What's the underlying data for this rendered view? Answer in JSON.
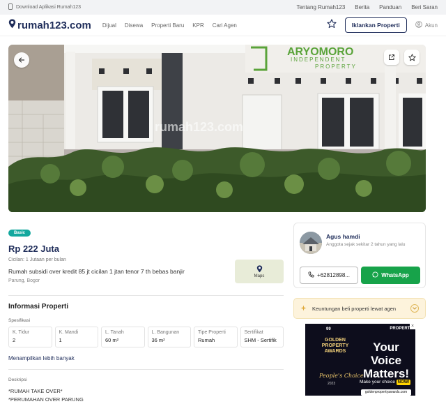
{
  "topbar": {
    "download_label": "Download Aplikasi Rumah123",
    "links": [
      "Tentang Rumah123",
      "Berita",
      "Panduan",
      "Beri Saran"
    ]
  },
  "nav": {
    "logo_text": "rumah123.com",
    "links": [
      "Dijual",
      "Disewa",
      "Properti Baru",
      "KPR",
      "Cari Agen"
    ],
    "iklan_label": "Iklankan Properti",
    "akun_label": "Akun"
  },
  "hero": {
    "watermark": "rumah123.com",
    "sign_line1": "ARYOMORO",
    "sign_line2": "INDEPENDENT",
    "sign_line3": "PROPERTY"
  },
  "listing": {
    "badge": "Basic",
    "price": "Rp 222 Juta",
    "cicilan": "Cicilan: 1 Jutaan per bulan",
    "title": "Rumah subsidi over kredit 85 jt cicilan 1 jtan tenor 7 th bebas banjir",
    "location": "Parung, Bogor",
    "maps_label": "Maps"
  },
  "info": {
    "title": "Informasi Properti",
    "spec_label": "Spesifikasi",
    "specs": [
      {
        "k": "K. Tidur",
        "v": "2"
      },
      {
        "k": "K. Mandi",
        "v": "1"
      },
      {
        "k": "L. Tanah",
        "v": "60 m²"
      },
      {
        "k": "L. Bangunan",
        "v": "36 m²"
      },
      {
        "k": "Tipe Properti",
        "v": "Rumah"
      },
      {
        "k": "Sertifikat",
        "v": "SHM - Sertifik"
      }
    ],
    "more_label": "Menampilkan lebih banyak",
    "desc_label": "Deskripsi",
    "desc_lines": [
      "*RUMAH TAKE OVER*",
      "*PERUMAHAN OVER PARUNG"
    ]
  },
  "agent": {
    "name": "Agus hamdi",
    "since": "Anggota sejak sekitar 2 tahun yang lalu",
    "phone": "+62812898...",
    "whatsapp": "WhatsApp"
  },
  "benefit": {
    "label": "Keuntungan beli properti lewat agen"
  },
  "ad": {
    "logo": "99",
    "award_lines": [
      "GOLDEN",
      "PROPERTY",
      "AWARDS"
    ],
    "peoples_choice": "People's Choice",
    "year": "2023",
    "brand": "PROPERTI",
    "headline_lines": [
      "Your",
      "Voice",
      "Matters!"
    ],
    "cta_text": "Make your choice",
    "cta_now": "NOW!",
    "site": "goldenpropertyawards.com",
    "close": "×"
  },
  "colors": {
    "navy": "#1f2d5a",
    "teal": "#13a89e",
    "whatsapp": "#17a34a",
    "benefit_bg": "#fdf3dc"
  }
}
